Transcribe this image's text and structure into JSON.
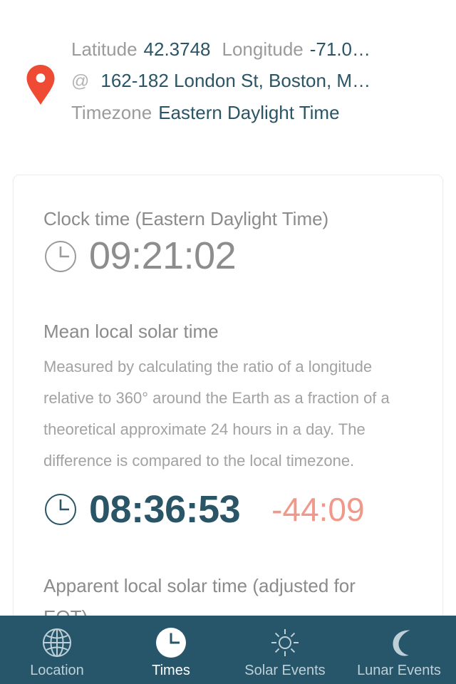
{
  "location": {
    "pin_icon": "map-pin-icon",
    "latitude_label": "Latitude",
    "latitude_value": "42.3748",
    "longitude_label": "Longitude",
    "longitude_value": "-71.0…",
    "at_symbol": "@",
    "address_value": "162-182 London St, Boston, M…",
    "timezone_label": "Timezone",
    "timezone_value": "Eastern Daylight Time"
  },
  "card": {
    "clock": {
      "title": "Clock time (Eastern Daylight Time)",
      "icon": "clock-icon",
      "value": "09:21:02"
    },
    "mean_solar": {
      "title": "Mean local solar time",
      "description": "Measured by calculating the ratio of a longitude relative to 360° around the Earth as a fraction of a theoretical approximate 24 hours in a day. The difference is compared to the local timezone.",
      "icon": "clock-icon",
      "value": "08:36:53",
      "delta": "-44:09"
    },
    "apparent_solar": {
      "title": "Apparent local solar time (adjusted for EOT)"
    }
  },
  "tabbar": {
    "tabs": [
      {
        "label": "Location",
        "icon": "globe-icon",
        "active": false
      },
      {
        "label": "Times",
        "icon": "clock-icon",
        "active": true
      },
      {
        "label": "Solar Events",
        "icon": "sun-icon",
        "active": false
      },
      {
        "label": "Lunar Events",
        "icon": "moon-icon",
        "active": false
      }
    ]
  },
  "colors": {
    "accent_teal": "#27566b",
    "value_teal": "#2a5566",
    "pin_red": "#ef4a33",
    "delta_salmon": "#f0998a",
    "muted_gray": "#8b8b8b"
  }
}
